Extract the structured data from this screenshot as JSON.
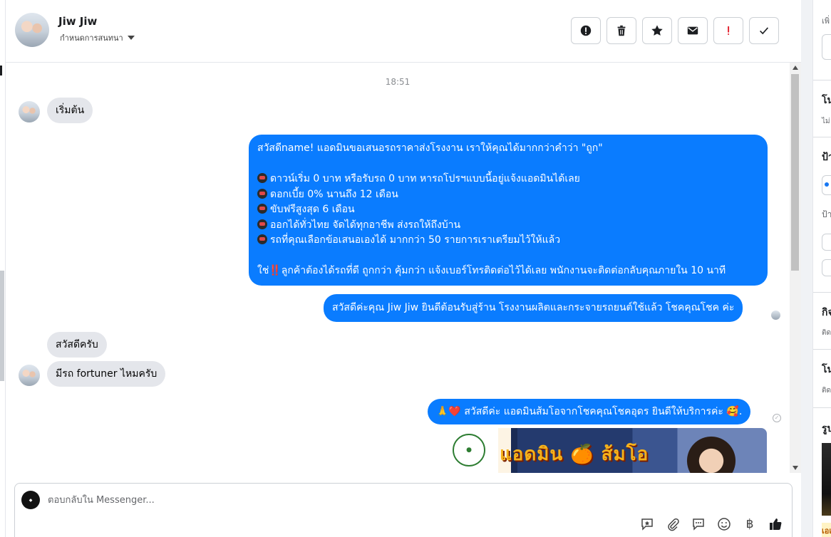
{
  "header": {
    "contact_name": "Jiw Jiw",
    "assign_label": "กำหนดการสนทนา",
    "actions": [
      {
        "name": "mark-important-button",
        "icon": "alert-circle-icon"
      },
      {
        "name": "delete-button",
        "icon": "trash-icon"
      },
      {
        "name": "star-button",
        "icon": "star-icon"
      },
      {
        "name": "mark-unread-button",
        "icon": "envelope-icon"
      },
      {
        "name": "mark-spam-button",
        "icon": "exclamation-icon"
      },
      {
        "name": "mark-done-button",
        "icon": "check-icon"
      }
    ]
  },
  "chat": {
    "timestamp": "18:51",
    "messages": {
      "m1": "เริ่มต้น",
      "m2_lines": [
        "สวัสดีname! แอดมินขอเสนอรถราคาส่งโรงงาน เราให้คุณได้มากกว่าคำว่า \"ถูก\"",
        "",
        "ดาวน์เริ่ม 0 บาท หรือรับรถ 0 บาท หารถโปรฯแบบนี้อยู่แจ้งแอดมินได้เลย",
        "ดอกเบี้ย 0% นานถึง 12 เดือน",
        "ขับฟรีสูงสุด 6 เดือน",
        "ออกได้ทั่วไทย จัดได้ทุกอาชีพ ส่งรถให้ถึงบ้าน",
        "รถที่คุณเลือกข้อเสนอเองได้ มากกว่า 50 รายการเราเตรียมไว้ให้แล้ว",
        "",
        "ใช่",
        "‼️",
        "ลูกค้าต้องได้รถที่ดี ถูกกว่า คุ้มกว่า แจ้งเบอร์โทรติดต่อไว้ได้เลย พนักงานจะติดต่อกลับคุณภายใน 10 นาที"
      ],
      "m3": "สวัสดีค่ะคุณ Jiw Jiw ยินดีต้อนรับสู่ร้าน โรงงานผลิตและกระจายรถยนต์ใช้แล้ว โชคคุณโชค ค่ะ",
      "m4": "สวัสดีครับ",
      "m5": "มีรถ fortuner ไหมครับ",
      "m6_prefix": "🙏❤️",
      "m6_text": "สวัสดีค่ะ แอดมินส้มโอจากโชคคุณโชคอุดร ยินดีให้บริการค่ะ",
      "m6_suffix": "🥰.",
      "promo_title": "แอดมิน 🍊 ส้มโอ"
    }
  },
  "composer": {
    "placeholder": "ตอบกลับใน Messenger...",
    "baht_symbol": "฿"
  },
  "right_panel": {
    "t1": "เพิ่",
    "t2": "โน",
    "t2_sub": "ไม่",
    "t3": "ป้า",
    "t3_sub": "ป้า",
    "t4": "กิจ",
    "t4_sub": "ติด",
    "t5": "โน",
    "t5_sub": "ติด",
    "t6": "รูป",
    "t7": "เอเ"
  },
  "colors": {
    "outgoing_bubble": "#0a7cff",
    "incoming_bubble": "#e4e6eb",
    "accent": "#1877f2"
  }
}
